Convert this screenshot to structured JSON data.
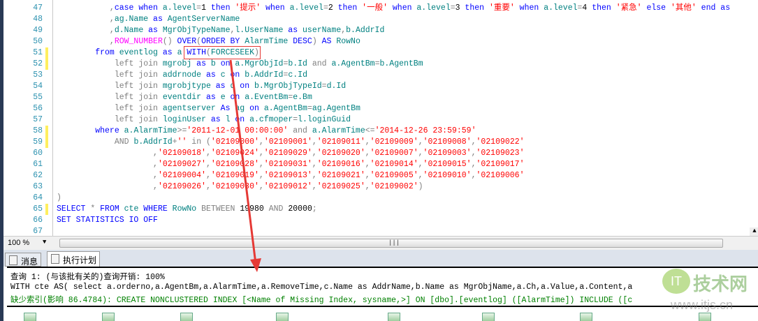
{
  "editor": {
    "lines": [
      {
        "n": "47",
        "mark": false,
        "t": [
          [
            "n",
            "           "
          ],
          [
            "g",
            ","
          ],
          [
            "k",
            "case when "
          ],
          [
            "i",
            "a.level"
          ],
          [
            "g",
            "="
          ],
          [
            "n",
            "1"
          ],
          [
            "k",
            " then "
          ],
          [
            "s",
            "'提示'"
          ],
          [
            "k",
            " when "
          ],
          [
            "i",
            "a.level"
          ],
          [
            "g",
            "="
          ],
          [
            "n",
            "2"
          ],
          [
            "k",
            " then "
          ],
          [
            "s",
            "'一般'"
          ],
          [
            "k",
            " when "
          ],
          [
            "i",
            "a.level"
          ],
          [
            "g",
            "="
          ],
          [
            "n",
            "3"
          ],
          [
            "k",
            " then "
          ],
          [
            "s",
            "'重要'"
          ],
          [
            "k",
            " when "
          ],
          [
            "i",
            "a.level"
          ],
          [
            "g",
            "="
          ],
          [
            "n",
            "4"
          ],
          [
            "k",
            " then "
          ],
          [
            "s",
            "'紧急'"
          ],
          [
            "k",
            " else "
          ],
          [
            "s",
            "'其他'"
          ],
          [
            "k",
            " end as"
          ]
        ]
      },
      {
        "n": "48",
        "mark": false,
        "t": [
          [
            "n",
            "           "
          ],
          [
            "g",
            ","
          ],
          [
            "i",
            "ag.Name"
          ],
          [
            "k",
            " as "
          ],
          [
            "i",
            "AgentServerName"
          ]
        ]
      },
      {
        "n": "49",
        "mark": false,
        "t": [
          [
            "n",
            "           "
          ],
          [
            "g",
            ","
          ],
          [
            "i",
            "d.Name"
          ],
          [
            "k",
            " as "
          ],
          [
            "i",
            "MgrObjTypeName"
          ],
          [
            "g",
            ","
          ],
          [
            "i",
            "l.UserName"
          ],
          [
            "k",
            " as "
          ],
          [
            "i",
            "userName"
          ],
          [
            "g",
            ","
          ],
          [
            "i",
            "b.AddrId"
          ]
        ]
      },
      {
        "n": "50",
        "mark": false,
        "t": [
          [
            "n",
            "           "
          ],
          [
            "g",
            ","
          ],
          [
            "f",
            "ROW_NUMBER"
          ],
          [
            "g",
            "()"
          ],
          [
            "k",
            " OVER"
          ],
          [
            "g",
            "("
          ],
          [
            "k",
            "ORDER BY"
          ],
          [
            "i",
            " AlarmTime"
          ],
          [
            "k",
            " DESC"
          ],
          [
            "g",
            ")"
          ],
          [
            "k",
            " AS"
          ],
          [
            "i",
            " RowNo"
          ]
        ]
      },
      {
        "n": "51",
        "mark": true,
        "t": [
          [
            "n",
            "        "
          ],
          [
            "k",
            "from"
          ],
          [
            "i",
            " eventlog"
          ],
          [
            "k",
            " as"
          ],
          [
            "i",
            " a "
          ],
          [
            "k",
            "WITH"
          ],
          [
            "g",
            "("
          ],
          [
            "i",
            "FORCESEEK"
          ],
          [
            "g",
            ")"
          ]
        ]
      },
      {
        "n": "52",
        "mark": true,
        "t": [
          [
            "n",
            "            "
          ],
          [
            "g",
            "left join"
          ],
          [
            "i",
            " mgrobj"
          ],
          [
            "k",
            " as"
          ],
          [
            "i",
            " b"
          ],
          [
            "k",
            " on"
          ],
          [
            "i",
            " a.MgrObjId"
          ],
          [
            "g",
            "="
          ],
          [
            "i",
            "b.Id"
          ],
          [
            "g",
            " and"
          ],
          [
            "i",
            " a.AgentBm"
          ],
          [
            "g",
            "="
          ],
          [
            "i",
            "b.AgentBm"
          ]
        ]
      },
      {
        "n": "53",
        "mark": false,
        "t": [
          [
            "n",
            "            "
          ],
          [
            "g",
            "left join"
          ],
          [
            "i",
            " addrnode"
          ],
          [
            "k",
            " as"
          ],
          [
            "i",
            " c"
          ],
          [
            "k",
            " on"
          ],
          [
            "i",
            " b.AddrId"
          ],
          [
            "g",
            "="
          ],
          [
            "i",
            "c.Id"
          ]
        ]
      },
      {
        "n": "54",
        "mark": false,
        "t": [
          [
            "n",
            "            "
          ],
          [
            "g",
            "left join"
          ],
          [
            "i",
            " mgrobjtype"
          ],
          [
            "k",
            " as"
          ],
          [
            "i",
            " d"
          ],
          [
            "k",
            " on"
          ],
          [
            "i",
            " b.MgrObjTypeId"
          ],
          [
            "g",
            "="
          ],
          [
            "i",
            "d.Id"
          ]
        ]
      },
      {
        "n": "55",
        "mark": false,
        "t": [
          [
            "n",
            "            "
          ],
          [
            "g",
            "left join"
          ],
          [
            "i",
            " eventdir"
          ],
          [
            "k",
            " as"
          ],
          [
            "i",
            " e"
          ],
          [
            "k",
            " on"
          ],
          [
            "i",
            " a.EventBm"
          ],
          [
            "g",
            "="
          ],
          [
            "i",
            "e.Bm"
          ]
        ]
      },
      {
        "n": "56",
        "mark": false,
        "t": [
          [
            "n",
            "            "
          ],
          [
            "g",
            "left join"
          ],
          [
            "i",
            " agentserver"
          ],
          [
            "k",
            " As"
          ],
          [
            "i",
            " ag"
          ],
          [
            "k",
            " on"
          ],
          [
            "i",
            " a.AgentBm"
          ],
          [
            "g",
            "="
          ],
          [
            "i",
            "ag.AgentBm"
          ]
        ]
      },
      {
        "n": "57",
        "mark": false,
        "t": [
          [
            "n",
            "            "
          ],
          [
            "g",
            "left join"
          ],
          [
            "i",
            " loginUser"
          ],
          [
            "k",
            " as"
          ],
          [
            "i",
            " l"
          ],
          [
            "k",
            " on"
          ],
          [
            "i",
            " a.cfmoper"
          ],
          [
            "g",
            "="
          ],
          [
            "i",
            "l.loginGuid"
          ]
        ]
      },
      {
        "n": "58",
        "mark": true,
        "t": [
          [
            "n",
            "        "
          ],
          [
            "k",
            "where"
          ],
          [
            "i",
            " a.AlarmTime"
          ],
          [
            "g",
            ">="
          ],
          [
            "s",
            "'2011-12-01 00:00:00'"
          ],
          [
            "g",
            " and"
          ],
          [
            "i",
            " a.AlarmTime"
          ],
          [
            "g",
            "<="
          ],
          [
            "s",
            "'2014-12-26 23:59:59'"
          ]
        ]
      },
      {
        "n": "59",
        "mark": true,
        "t": [
          [
            "n",
            "            "
          ],
          [
            "g",
            "AND"
          ],
          [
            "i",
            " b.AddrId"
          ],
          [
            "g",
            "+"
          ],
          [
            "s",
            "''"
          ],
          [
            "g",
            " in ("
          ],
          [
            "s",
            "'02109000'"
          ],
          [
            "g",
            ","
          ],
          [
            "s",
            "'02109001'"
          ],
          [
            "g",
            ","
          ],
          [
            "s",
            "'02109011'"
          ],
          [
            "g",
            ","
          ],
          [
            "s",
            "'02109009'"
          ],
          [
            "g",
            ","
          ],
          [
            "s",
            "'02109008'"
          ],
          [
            "g",
            ","
          ],
          [
            "s",
            "'02109022'"
          ]
        ]
      },
      {
        "n": "60",
        "mark": false,
        "t": [
          [
            "n",
            "                    "
          ],
          [
            "g",
            ","
          ],
          [
            "s",
            "'02109018'"
          ],
          [
            "g",
            ","
          ],
          [
            "s",
            "'02109024'"
          ],
          [
            "g",
            ","
          ],
          [
            "s",
            "'02109029'"
          ],
          [
            "g",
            ","
          ],
          [
            "s",
            "'02109020'"
          ],
          [
            "g",
            ","
          ],
          [
            "s",
            "'02109007'"
          ],
          [
            "g",
            ","
          ],
          [
            "s",
            "'02109003'"
          ],
          [
            "g",
            ","
          ],
          [
            "s",
            "'02109023'"
          ]
        ]
      },
      {
        "n": "61",
        "mark": false,
        "t": [
          [
            "n",
            "                    "
          ],
          [
            "g",
            ","
          ],
          [
            "s",
            "'02109027'"
          ],
          [
            "g",
            ","
          ],
          [
            "s",
            "'02109028'"
          ],
          [
            "g",
            ","
          ],
          [
            "s",
            "'02109031'"
          ],
          [
            "g",
            ","
          ],
          [
            "s",
            "'02109016'"
          ],
          [
            "g",
            ","
          ],
          [
            "s",
            "'02109014'"
          ],
          [
            "g",
            ","
          ],
          [
            "s",
            "'02109015'"
          ],
          [
            "g",
            ","
          ],
          [
            "s",
            "'02109017'"
          ]
        ]
      },
      {
        "n": "62",
        "mark": false,
        "t": [
          [
            "n",
            "                    "
          ],
          [
            "g",
            ","
          ],
          [
            "s",
            "'02109004'"
          ],
          [
            "g",
            ","
          ],
          [
            "s",
            "'02109019'"
          ],
          [
            "g",
            ","
          ],
          [
            "s",
            "'02109013'"
          ],
          [
            "g",
            ","
          ],
          [
            "s",
            "'02109021'"
          ],
          [
            "g",
            ","
          ],
          [
            "s",
            "'02109005'"
          ],
          [
            "g",
            ","
          ],
          [
            "s",
            "'02109010'"
          ],
          [
            "g",
            ","
          ],
          [
            "s",
            "'02109006'"
          ]
        ]
      },
      {
        "n": "63",
        "mark": false,
        "t": [
          [
            "n",
            "                    "
          ],
          [
            "g",
            ","
          ],
          [
            "s",
            "'02109026'"
          ],
          [
            "g",
            ","
          ],
          [
            "s",
            "'02109030'"
          ],
          [
            "g",
            ","
          ],
          [
            "s",
            "'02109012'"
          ],
          [
            "g",
            ","
          ],
          [
            "s",
            "'02109025'"
          ],
          [
            "g",
            ","
          ],
          [
            "s",
            "'02109002'"
          ],
          [
            "g",
            ")"
          ]
        ]
      },
      {
        "n": "64",
        "mark": false,
        "t": [
          [
            "g",
            ")"
          ]
        ]
      },
      {
        "n": "65",
        "mark": true,
        "t": [
          [
            "k",
            "SELECT"
          ],
          [
            "g",
            " * "
          ],
          [
            "k",
            "FROM"
          ],
          [
            "i",
            " cte"
          ],
          [
            "k",
            " WHERE"
          ],
          [
            "i",
            " RowNo"
          ],
          [
            "g",
            " BETWEEN "
          ],
          [
            "n",
            "19980"
          ],
          [
            "g",
            " AND "
          ],
          [
            "n",
            "20000"
          ],
          [
            "g",
            ";"
          ]
        ]
      },
      {
        "n": "66",
        "mark": false,
        "t": [
          [
            "k",
            "SET STATISTICS IO OFF"
          ]
        ]
      },
      {
        "n": "67",
        "mark": false,
        "t": []
      }
    ]
  },
  "zoom": {
    "value": "100 %"
  },
  "tabs": [
    {
      "label": "消息",
      "icon": "messages-icon"
    },
    {
      "label": "执行计划",
      "icon": "execution-plan-icon",
      "active": true
    }
  ],
  "results": {
    "line1": "查询 1: (与该批有关的)查询开销: 100%",
    "line2": "WITH cte AS( select a.orderno,a.AgentBm,a.AlarmTime,a.RemoveTime,c.Name as AddrName,b.Name as MgrObjName,a.Ch,a.Value,a.Content,a",
    "line3_label": "缺少索引(影响",
    "line3": " 86.4784): CREATE NONCLUSTERED INDEX [<Name of Missing Index, sysname,>] ON [dbo].[eventlog] ([AlarmTime]) INCLUDE ([c"
  },
  "watermark": {
    "logo": "IT",
    "text": "技术网",
    "url": "www.itjs.cn"
  },
  "colors": {
    "keyword": "#0000ff",
    "identifier": "#008080",
    "string": "#ff0000",
    "operator": "#808080",
    "function": "#ff00ff",
    "annotation": "#e53935"
  }
}
